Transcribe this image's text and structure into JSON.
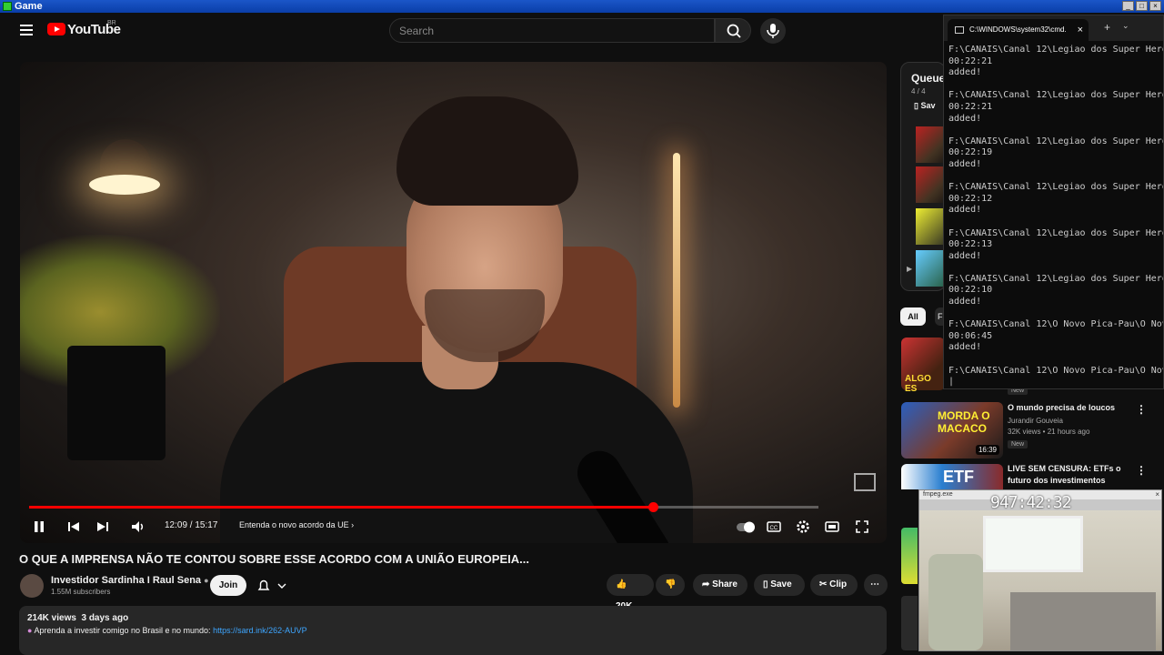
{
  "window": {
    "title": "Game"
  },
  "header": {
    "logo_text": "YouTube",
    "logo_region": "BR",
    "search_placeholder": "Search"
  },
  "player": {
    "progress": 0.79,
    "time_current": "12:09",
    "time_sep": " / ",
    "time_total": "15:17",
    "chapter": "Entenda o novo acordo da UE"
  },
  "video": {
    "title": "O QUE A IMPRENSA NÃO TE CONTOU SOBRE ESSE ACORDO COM A UNIÃO EUROPEIA...",
    "channel": "Investidor Sardinha I Raul Sena",
    "subscribers": "1.55M subscribers",
    "join_label": "Join",
    "like_count": "20K",
    "share_label": "Share",
    "save_label": "Save",
    "clip_label": "Clip",
    "views_date": "214K views  3 days ago",
    "desc_text": "Aprenda a investir comigo no Brasil e no mundo: ",
    "desc_link": "https://sard.ink/262-AUVP"
  },
  "queue": {
    "title": "Queue",
    "count": "4 / 4",
    "save_label": "Sav"
  },
  "filters": {
    "all": "All",
    "next": "F"
  },
  "recommendations": [
    {
      "title": "O mundo precisa de loucos",
      "channel": "Jurandir Gouveia",
      "meta": "32K views • 21 hours ago",
      "badge": "New",
      "duration": "16:39",
      "thumb_text": "MORDA O MACACO"
    },
    {
      "title": "LIVE SEM CENSURA: ETFs o futuro dos investimentos",
      "thumb_text": "ETF"
    }
  ],
  "rec_top": {
    "thumb_text": "ALGO ES",
    "badge": "New"
  },
  "cmd": {
    "tab_title": "C:\\WINDOWS\\system32\\cmd.",
    "lines": [
      "F:\\CANAIS\\Canal 12\\Legiao dos Super Hero",
      "00:22:21",
      "added!",
      "",
      "F:\\CANAIS\\Canal 12\\Legiao dos Super Hero",
      "00:22:21",
      "added!",
      "",
      "F:\\CANAIS\\Canal 12\\Legiao dos Super Hero",
      "00:22:19",
      "added!",
      "",
      "F:\\CANAIS\\Canal 12\\Legiao dos Super Hero",
      "00:22:12",
      "added!",
      "",
      "F:\\CANAIS\\Canal 12\\Legiao dos Super Hero",
      "00:22:13",
      "added!",
      "",
      "F:\\CANAIS\\Canal 12\\Legiao dos Super Hero",
      "00:22:10",
      "added!",
      "",
      "F:\\CANAIS\\Canal 12\\O Novo Pica-Pau\\O Nov",
      "00:06:45",
      "added!",
      "",
      "F:\\CANAIS\\Canal 12\\O Novo Pica-Pau\\O Nov"
    ]
  },
  "cam": {
    "title": "fmpeg.exe",
    "clock": "947:42:32"
  },
  "colors": {
    "accent": "#ff0000",
    "link": "#3ea6ff",
    "bg": "#0f0f0f"
  }
}
